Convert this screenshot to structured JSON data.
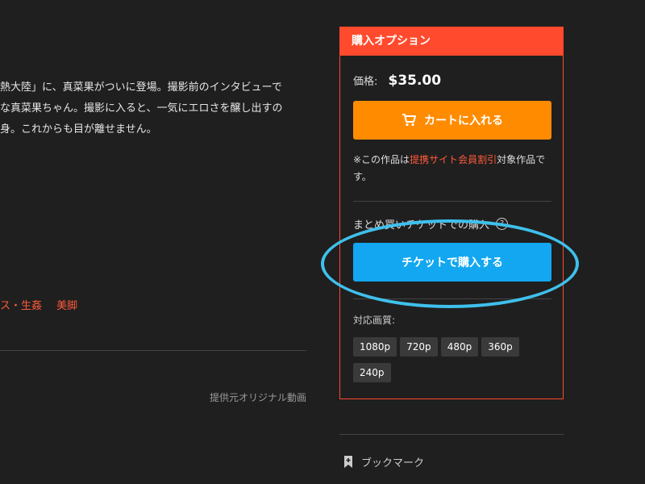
{
  "description": {
    "lines": [
      "熱大陸」に、真菜果がついに登場。撮影前のインタビューで",
      "な真菜果ちゃん。撮影に入ると、一気にエロさを醸し出すの",
      "身。これからも目が離せません。"
    ]
  },
  "tags": [
    "ス・生姦",
    "美脚"
  ],
  "source_label": "提供元オリジナル動画",
  "purchase_panel": {
    "header": "購入オプション",
    "price_label": "価格:",
    "price_value": "$35.00",
    "cart_button_label": "カートに入れる",
    "note_prefix": "※この作品は",
    "note_highlight": "提携サイト会員割引",
    "note_suffix": "対象作品です。",
    "ticket_label": "まとめ買いチケットでの購入",
    "ticket_button_label": "チケットで購入する",
    "quality_label": "対応画質:",
    "qualities": [
      "1080p",
      "720p",
      "480p",
      "360p",
      "240p"
    ]
  },
  "bookmark_label": "ブックマーク",
  "colors": {
    "background": "#1f1f1f",
    "accent_red": "#ff4a2d",
    "cart_orange": "#ff8c00",
    "ticket_blue": "#12a7f0",
    "annotation_cyan": "#3fc0ec"
  },
  "icons": {
    "cart": "cart-icon",
    "help": "help-icon",
    "bookmark": "bookmark-icon"
  }
}
